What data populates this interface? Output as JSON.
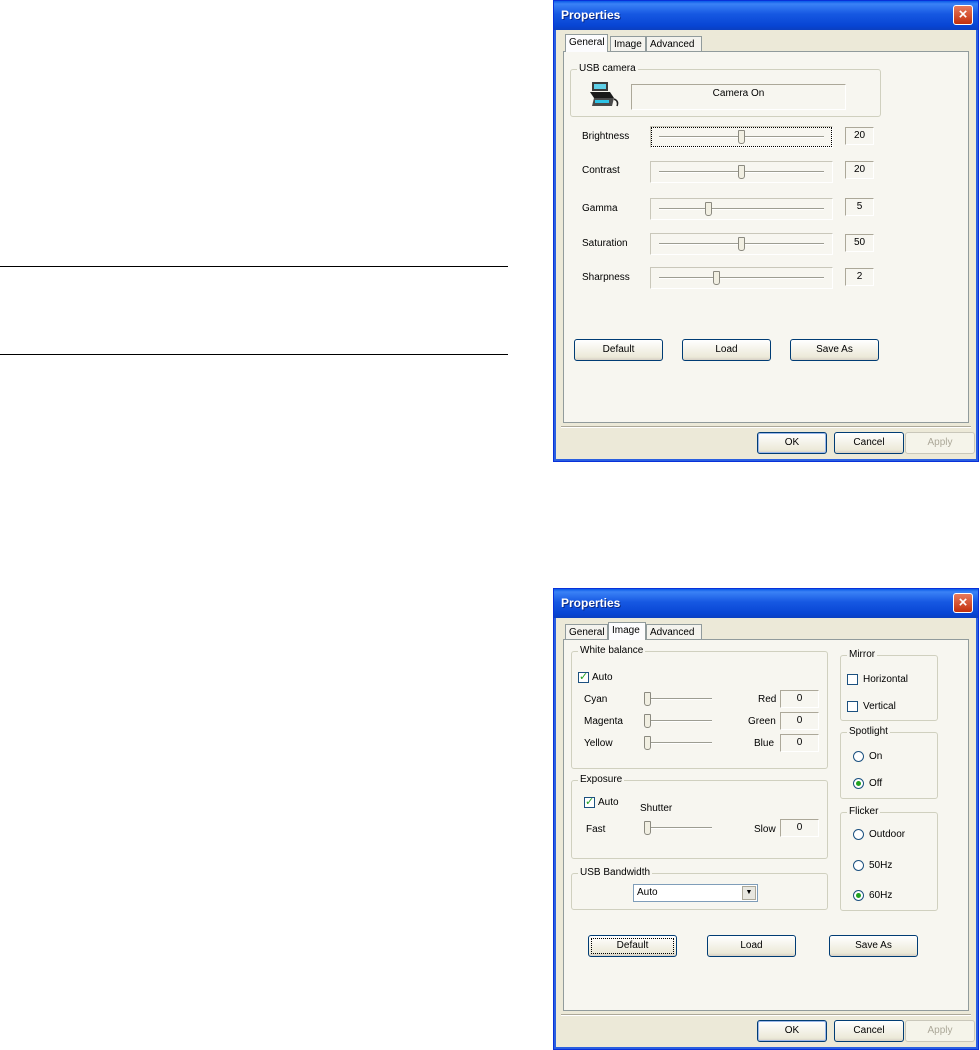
{
  "page": {
    "background": "#ffffff"
  },
  "window1": {
    "title": "Properties",
    "close_glyph": "×",
    "tabs": [
      "General",
      "Image",
      "Advanced"
    ],
    "active_tab": "General",
    "usb_camera": {
      "group_label": "USB camera",
      "status": "Camera On",
      "icon": "usb-camera-icon"
    },
    "sliders": [
      {
        "label": "Brightness",
        "value": "20",
        "position": 0.5
      },
      {
        "label": "Contrast",
        "value": "20",
        "position": 0.5
      },
      {
        "label": "Gamma",
        "value": "5",
        "position": 0.3
      },
      {
        "label": "Saturation",
        "value": "50",
        "position": 0.5
      },
      {
        "label": "Sharpness",
        "value": "2",
        "position": 0.35
      }
    ],
    "buttons": {
      "default": "Default",
      "load": "Load",
      "save_as": "Save As"
    },
    "footer": {
      "ok": "OK",
      "cancel": "Cancel",
      "apply": "Apply"
    }
  },
  "window2": {
    "title": "Properties",
    "close_glyph": "×",
    "tabs": [
      "General",
      "Image",
      "Advanced"
    ],
    "active_tab": "Image",
    "white_balance": {
      "group_label": "White balance",
      "auto_label": "Auto",
      "auto_checked": true,
      "rows": [
        {
          "left": "Cyan",
          "right": "Red",
          "value": "0"
        },
        {
          "left": "Magenta",
          "right": "Green",
          "value": "0"
        },
        {
          "left": "Yellow",
          "right": "Blue",
          "value": "0"
        }
      ]
    },
    "exposure": {
      "group_label": "Exposure",
      "auto_label": "Auto",
      "auto_checked": true,
      "shutter_label": "Shutter",
      "fast_label": "Fast",
      "slow_label": "Slow",
      "value": "0"
    },
    "usb_bandwidth": {
      "group_label": "USB Bandwidth",
      "selected": "Auto"
    },
    "mirror": {
      "group_label": "Mirror",
      "horizontal": "Horizontal",
      "vertical": "Vertical",
      "horizontal_checked": false,
      "vertical_checked": false
    },
    "spotlight": {
      "group_label": "Spotlight",
      "on": "On",
      "off": "Off",
      "selected": "Off"
    },
    "flicker": {
      "group_label": "Flicker",
      "outdoor": "Outdoor",
      "hz50": "50Hz",
      "hz60": "60Hz",
      "selected": "60Hz"
    },
    "buttons": {
      "default": "Default",
      "load": "Load",
      "save_as": "Save As"
    },
    "footer": {
      "ok": "OK",
      "cancel": "Cancel",
      "apply": "Apply"
    }
  }
}
